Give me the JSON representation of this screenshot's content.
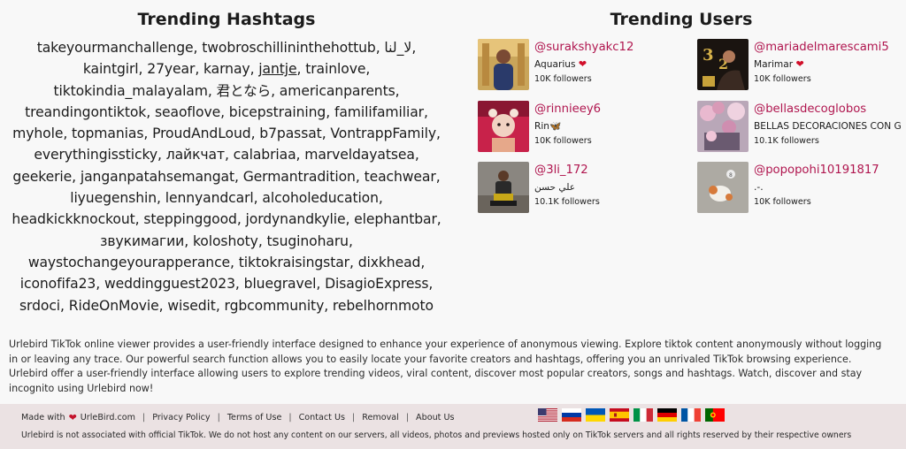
{
  "hashtags": {
    "title": "Trending Hashtags",
    "items": [
      "takeyourmanchallenge",
      "twobroschillininthehottub",
      "لا_لنا",
      "kaintgirl",
      "27year",
      "karnay",
      "jantje",
      "trainlove",
      "tiktokindia_malayalam",
      "君となら",
      "americanparents",
      "treandingontiktok",
      "seaoflove",
      "bicepstraining",
      "familifamiliar",
      "myhole",
      "topmanias",
      "ProudAndLoud",
      "b7passat",
      "VontrappFamily",
      "everythingissticky",
      "лайкчат",
      "calabriaa",
      "marveldayatsea",
      "geekerie",
      "janganpatahsemangat",
      "Germantradition",
      "teachwear",
      "liyuegenshin",
      "lennyandcarl",
      "alcoholeducation",
      "headkickknockout",
      "steppinggood",
      "jordynandkylie",
      "elephantbar",
      "звукимагии",
      "koloshoty",
      "tsuginoharu",
      "waystochangeyourapperance",
      "tiktokraisingstar",
      "dixkhead",
      "iconofifa23",
      "weddingguest2023",
      "bluegravel",
      "DisagioExpress",
      "srdoci",
      "RideOnMovie",
      "wisedit",
      "rgbcommunity",
      "rebelhornmoto"
    ]
  },
  "users": {
    "title": "Trending Users",
    "items": [
      {
        "handle": "@surakshyakc12",
        "nickname": "Aquarius",
        "nick_emoji": "❤",
        "followers": "10K followers"
      },
      {
        "handle": "@mariadelmarescami5",
        "nickname": "Marimar",
        "nick_emoji": "❤",
        "followers": "10K followers"
      },
      {
        "handle": "@rinnieey6",
        "nickname": "Rin",
        "nick_emoji": "🦋",
        "followers": "10K followers"
      },
      {
        "handle": "@bellasdecoglobos",
        "nickname": "BELLAS DECORACIONES CON G",
        "nick_emoji": "",
        "followers": "10.1K followers"
      },
      {
        "handle": "@3li_172",
        "nickname": "علي حسن",
        "nick_emoji": "",
        "followers": "10.1K followers"
      },
      {
        "handle": "@popopohi10191817",
        "nickname": ".-.",
        "nick_emoji": "",
        "followers": "10K followers"
      }
    ]
  },
  "description": "Urlebird TikTok online viewer provides a user-friendly interface designed to enhance your experience of anonymous viewing. Explore tiktok content anonymously without logging in or leaving any trace. Our powerful search function allows you to easily locate your favorite creators and hashtags, offering you an unrivaled TikTok browsing experience. Urlebird offer a user-friendly interface allowing users to explore trending videos, viral content, discover most popular creators, songs and hashtags. Watch, discover and stay incognito using Urlebird now!",
  "footer": {
    "made_with": "Made with",
    "made_by": "UrleBird.com",
    "links": [
      "Privacy Policy",
      "Terms of Use",
      "Contact Us",
      "Removal",
      "About Us"
    ],
    "disclaimer": "Urlebird is not associated with official TikTok. We do not host any content on our servers, all videos, photos and previews hosted only on TikTok servers and all rights reserved by their respective owners",
    "flags": [
      "us-flag",
      "ru-flag",
      "ua-flag",
      "es-flag",
      "it-flag",
      "de-flag",
      "fr-flag",
      "pt-flag"
    ]
  },
  "colors": {
    "handle": "#b0164f",
    "footer_bg": "#ebe2e3",
    "page_bg": "#f8f8f8",
    "heart": "#d10f2a"
  }
}
